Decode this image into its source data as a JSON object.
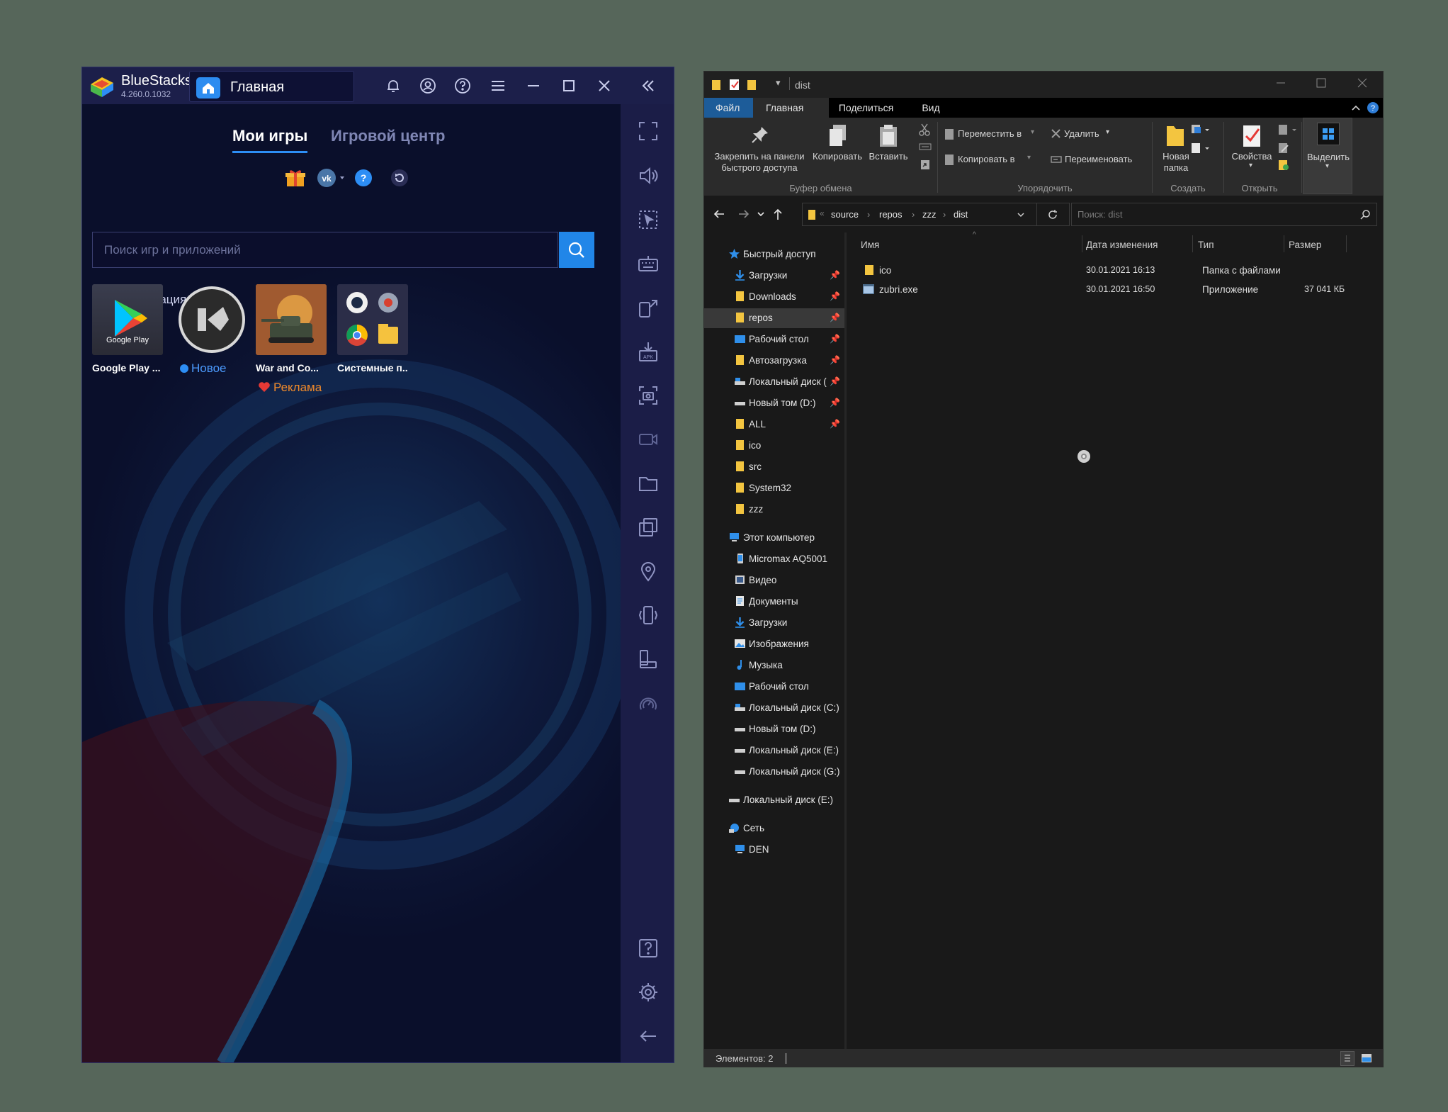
{
  "bluestacks": {
    "app_name": "BlueStacks",
    "version": "4.260.0.1032",
    "tab_label": "Главная",
    "tabs": [
      "Мои игры",
      "Игровой центр"
    ],
    "search_placeholder": "Поиск игр и приложений",
    "personalization_label": "Персонализация",
    "apps": [
      {
        "name": "Google Play ...",
        "tile_text": "Google Play"
      },
      {
        "name": "",
        "badge": "Новое"
      },
      {
        "name": "War and Co...",
        "badge": "Реклама"
      },
      {
        "name": "Системные п..."
      }
    ],
    "titlebar_icons": [
      "bell-icon",
      "account-icon",
      "help-icon",
      "menu-icon",
      "minimize-icon",
      "maximize-icon",
      "close-icon",
      "collapse-sidebar-icon"
    ],
    "sidebar_icons": [
      "fullscreen-icon",
      "volume-icon",
      "pointer-icon",
      "keyboard-icon",
      "multi-instance-icon",
      "apk-install-icon",
      "screenshot-icon",
      "record-icon",
      "folder-icon",
      "copy-icon",
      "location-icon",
      "shake-icon",
      "rotate-icon",
      "eco-mode-icon",
      "help-icon",
      "settings-icon",
      "back-icon"
    ],
    "accent_color": "#2186e8"
  },
  "explorer": {
    "title": "dist",
    "ribbon_tabs": [
      "Файл",
      "Главная",
      "Поделиться",
      "Вид"
    ],
    "ribbon": {
      "pin_label_1": "Закрепить на панели",
      "pin_label_2": "быстрого доступа",
      "copy": "Копировать",
      "paste": "Вставить",
      "clipboard_group": "Буфер обмена",
      "move_to": "Переместить в",
      "copy_to": "Копировать в",
      "delete": "Удалить",
      "rename": "Переименовать",
      "organize_group": "Упорядочить",
      "new_folder_1": "Новая",
      "new_folder_2": "папка",
      "create_group": "Создать",
      "properties": "Свойства",
      "open_group": "Открыть",
      "select": "Выделить"
    },
    "breadcrumb": [
      "source",
      "repos",
      "zzz",
      "dist"
    ],
    "search_placeholder": "Поиск: dist",
    "nav": {
      "quick_access": "Быстрый доступ",
      "quick_items": [
        {
          "label": "Загрузки",
          "pinned": true
        },
        {
          "label": "Downloads",
          "pinned": true
        },
        {
          "label": "repos",
          "pinned": true,
          "selected": true
        },
        {
          "label": "Рабочий стол",
          "pinned": true
        },
        {
          "label": "Автозагрузка",
          "pinned": true
        },
        {
          "label": "Локальный диск (C:)",
          "pinned": true
        },
        {
          "label": "Новый том (D:)",
          "pinned": true
        },
        {
          "label": "ALL",
          "pinned": true
        },
        {
          "label": "ico",
          "pinned": false
        },
        {
          "label": "src",
          "pinned": false
        },
        {
          "label": "System32",
          "pinned": false
        },
        {
          "label": "zzz",
          "pinned": false
        }
      ],
      "this_pc": "Этот компьютер",
      "pc_items": [
        "Micromax AQ5001",
        "Видео",
        "Документы",
        "Загрузки",
        "Изображения",
        "Музыка",
        "Рабочий стол",
        "Локальный диск (C:)",
        "Новый том (D:)",
        "Локальный диск (E:)",
        "Локальный диск (G:)"
      ],
      "drive_e": "Локальный диск (E:)",
      "network": "Сеть",
      "network_items": [
        "DEN"
      ]
    },
    "columns": [
      "Имя",
      "Дата изменения",
      "Тип",
      "Размер"
    ],
    "files": [
      {
        "name": "ico",
        "date": "30.01.2021 16:13",
        "type": "Папка с файлами",
        "size": ""
      },
      {
        "name": "zubri.exe",
        "date": "30.01.2021 16:50",
        "type": "Приложение",
        "size": "37 041 КБ"
      }
    ],
    "status": "Элементов: 2"
  }
}
